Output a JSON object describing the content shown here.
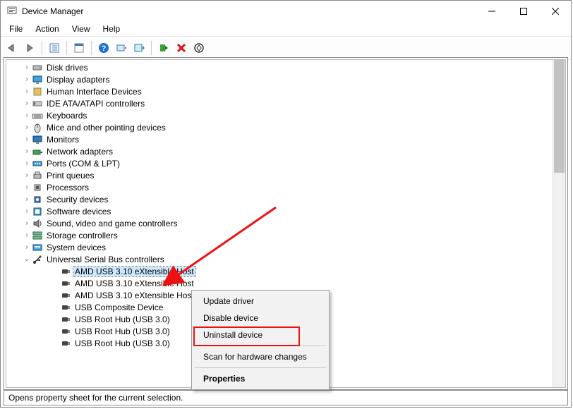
{
  "window": {
    "title": "Device Manager"
  },
  "menu": {
    "file": "File",
    "action": "Action",
    "view": "View",
    "help": "Help"
  },
  "tree": {
    "items": [
      {
        "label": "Disk drives",
        "icon": "disk"
      },
      {
        "label": "Display adapters",
        "icon": "display"
      },
      {
        "label": "Human Interface Devices",
        "icon": "hid"
      },
      {
        "label": "IDE ATA/ATAPI controllers",
        "icon": "ide"
      },
      {
        "label": "Keyboards",
        "icon": "keyboard"
      },
      {
        "label": "Mice and other pointing devices",
        "icon": "mouse"
      },
      {
        "label": "Monitors",
        "icon": "monitor"
      },
      {
        "label": "Network adapters",
        "icon": "network"
      },
      {
        "label": "Ports (COM & LPT)",
        "icon": "port"
      },
      {
        "label": "Print queues",
        "icon": "print"
      },
      {
        "label": "Processors",
        "icon": "cpu"
      },
      {
        "label": "Security devices",
        "icon": "security"
      },
      {
        "label": "Software devices",
        "icon": "software"
      },
      {
        "label": "Sound, video and game controllers",
        "icon": "sound"
      },
      {
        "label": "Storage controllers",
        "icon": "storage"
      },
      {
        "label": "System devices",
        "icon": "system"
      }
    ],
    "expanded": {
      "label": "Universal Serial Bus controllers",
      "icon": "usb",
      "children": [
        "AMD USB 3.10 eXtensible Host",
        "AMD USB 3.10 eXtensible Host",
        "AMD USB 3.10 eXtensible Host",
        "USB Composite Device",
        "USB Root Hub (USB 3.0)",
        "USB Root Hub (USB 3.0)",
        "USB Root Hub (USB 3.0)"
      ]
    }
  },
  "context_menu": {
    "update": "Update driver",
    "disable": "Disable device",
    "uninstall": "Uninstall device",
    "scan": "Scan for hardware changes",
    "properties": "Properties"
  },
  "statusbar": {
    "text": "Opens property sheet for the current selection."
  }
}
